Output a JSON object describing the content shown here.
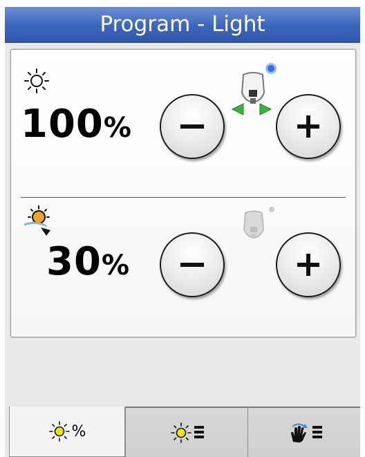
{
  "header": {
    "title": "Program - Light"
  },
  "main_light": {
    "value": "100",
    "unit": "%",
    "decrease_label": "−",
    "increase_label": "+",
    "indicator_color": "#2f6ee6"
  },
  "ambient_light": {
    "value": "30",
    "unit": "%",
    "decrease_label": "−",
    "increase_label": "+",
    "indicator_color": "#cccccc"
  },
  "tabs": [
    {
      "name": "intensity",
      "label": "%",
      "icon": "sun-icon",
      "active": true
    },
    {
      "name": "list",
      "icon": "sun-list-icon",
      "active": false
    },
    {
      "name": "gesture",
      "icon": "hand-gesture-icon",
      "active": false
    }
  ],
  "colors": {
    "title_bar": "#3c66bd",
    "sun_yellow": "#f5e600",
    "arrow_green": "#38b838"
  }
}
